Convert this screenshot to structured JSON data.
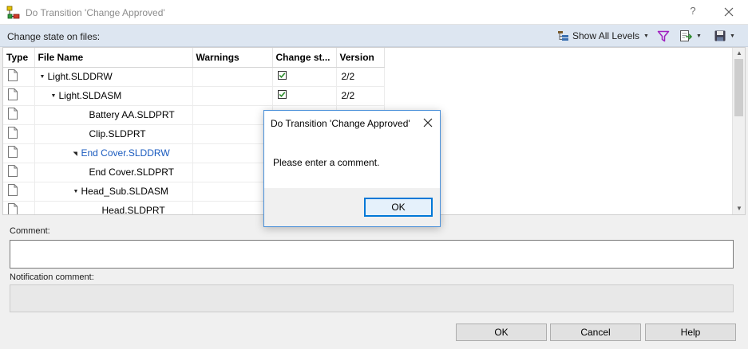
{
  "window": {
    "title": "Do Transition 'Change Approved'",
    "help_label": "?"
  },
  "toolbar": {
    "label": "Change state on files:",
    "show_levels_label": "Show All Levels"
  },
  "grid": {
    "columns": [
      "Type",
      "File Name",
      "Warnings",
      "Change st...",
      "Version"
    ],
    "rows": [
      {
        "name": "Light.SLDDRW",
        "toggle": "expanded",
        "indent": 0,
        "link": false,
        "checked": true,
        "version": "2/2"
      },
      {
        "name": "Light.SLDASM",
        "toggle": "expanded",
        "indent": 1,
        "link": false,
        "checked": true,
        "version": "2/2"
      },
      {
        "name": "Battery AA.SLDPRT",
        "toggle": "none",
        "indent": 2,
        "link": false,
        "checked": false,
        "version": ""
      },
      {
        "name": "Clip.SLDPRT",
        "toggle": "none",
        "indent": 2,
        "link": false,
        "checked": false,
        "version": ""
      },
      {
        "name": "End Cover.SLDDRW",
        "toggle": "collapsed",
        "indent": 2,
        "link": true,
        "checked": false,
        "version": ""
      },
      {
        "name": "End Cover.SLDPRT",
        "toggle": "none",
        "indent": 2,
        "link": false,
        "checked": false,
        "version": ""
      },
      {
        "name": "Head_Sub.SLDASM",
        "toggle": "expanded",
        "indent": 2,
        "link": false,
        "checked": false,
        "version": ""
      },
      {
        "name": "Head.SLDPRT",
        "toggle": "none",
        "indent": 3,
        "link": false,
        "checked": false,
        "version": ""
      }
    ]
  },
  "form": {
    "comment_label": "Comment:",
    "comment_value": "",
    "notification_label": "Notification comment:"
  },
  "buttons": {
    "ok": "OK",
    "cancel": "Cancel",
    "help": "Help"
  },
  "dialog": {
    "title": "Do Transition 'Change Approved'",
    "message": "Please enter a comment.",
    "ok": "OK"
  },
  "colors": {
    "toolbar_bg": "#dde6f1",
    "link": "#1a5bbf",
    "dialog_border": "#4a90d9",
    "dialog_button_border": "#0078d7",
    "checkbox_green": "#2f8f2f",
    "filter_icon": "#a020c0"
  },
  "icons": [
    "workflow-app-icon",
    "filter-icon",
    "export-icon",
    "save-icon",
    "file-icon",
    "checkbox-checked-icon"
  ]
}
